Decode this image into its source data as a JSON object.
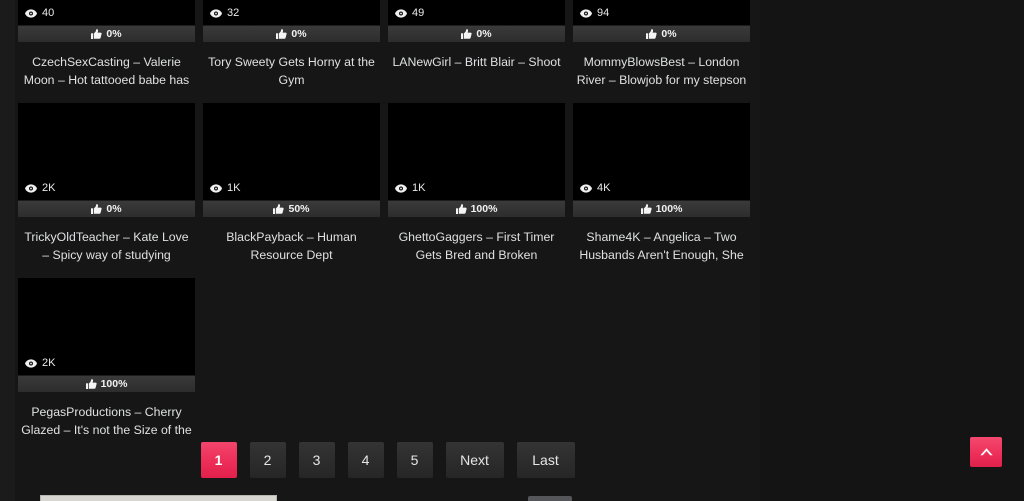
{
  "theme": {
    "background": "#141414",
    "content_background": "#161616",
    "accent": "#ec2e58",
    "text": "#dfe0e1",
    "thumb_background": "#000000",
    "rating_bar_background": "#343434"
  },
  "grid": {
    "cards": [
      {
        "title": "CzechSexCasting – Valerie Moon – Hot tattooed babe has great sex",
        "views": "40",
        "rating": "0%",
        "views_icon": "eye-icon",
        "rating_icon": "thumbs-up-icon"
      },
      {
        "title": "Tory Sweety Gets Horny at the Gym",
        "views": "32",
        "rating": "0%",
        "views_icon": "eye-icon",
        "rating_icon": "thumbs-up-icon"
      },
      {
        "title": "LANewGirl – Britt Blair – Shoot",
        "views": "49",
        "rating": "0%",
        "views_icon": "eye-icon",
        "rating_icon": "thumbs-up-icon"
      },
      {
        "title": "MommyBlowsBest – London River – Blowjob for my stepson",
        "views": "94",
        "rating": "0%",
        "views_icon": "eye-icon",
        "rating_icon": "thumbs-up-icon"
      },
      {
        "title": "TrickyOldTeacher – Kate Love – Spicy way of studying German",
        "views": "2K",
        "rating": "0%",
        "views_icon": "eye-icon",
        "rating_icon": "thumbs-up-icon"
      },
      {
        "title": "BlackPayback – Human Resource Dept",
        "views": "1K",
        "rating": "50%",
        "views_icon": "eye-icon",
        "rating_icon": "thumbs-up-icon"
      },
      {
        "title": "GhettoGaggers – First Timer Gets Bred and Broken",
        "views": "1K",
        "rating": "100%",
        "views_icon": "eye-icon",
        "rating_icon": "thumbs-up-icon"
      },
      {
        "title": "Shame4K – Angelica – Two Husbands Aren't Enough, She",
        "views": "4K",
        "rating": "100%",
        "views_icon": "eye-icon",
        "rating_icon": "thumbs-up-icon"
      },
      {
        "title": "PegasProductions – Cherry Glazed – It's not the Size of the",
        "views": "2K",
        "rating": "100%",
        "views_icon": "eye-icon",
        "rating_icon": "thumbs-up-icon"
      }
    ]
  },
  "pagination": {
    "items": [
      {
        "label": "1",
        "current": true
      },
      {
        "label": "2",
        "current": false
      },
      {
        "label": "3",
        "current": false
      },
      {
        "label": "4",
        "current": false
      },
      {
        "label": "5",
        "current": false
      },
      {
        "label": "Next",
        "current": false
      },
      {
        "label": "Last",
        "current": false
      }
    ]
  },
  "scroll_top": {
    "icon": "chevron-up-icon"
  },
  "bottom_bar": {
    "input_value": "",
    "button_label": ""
  }
}
